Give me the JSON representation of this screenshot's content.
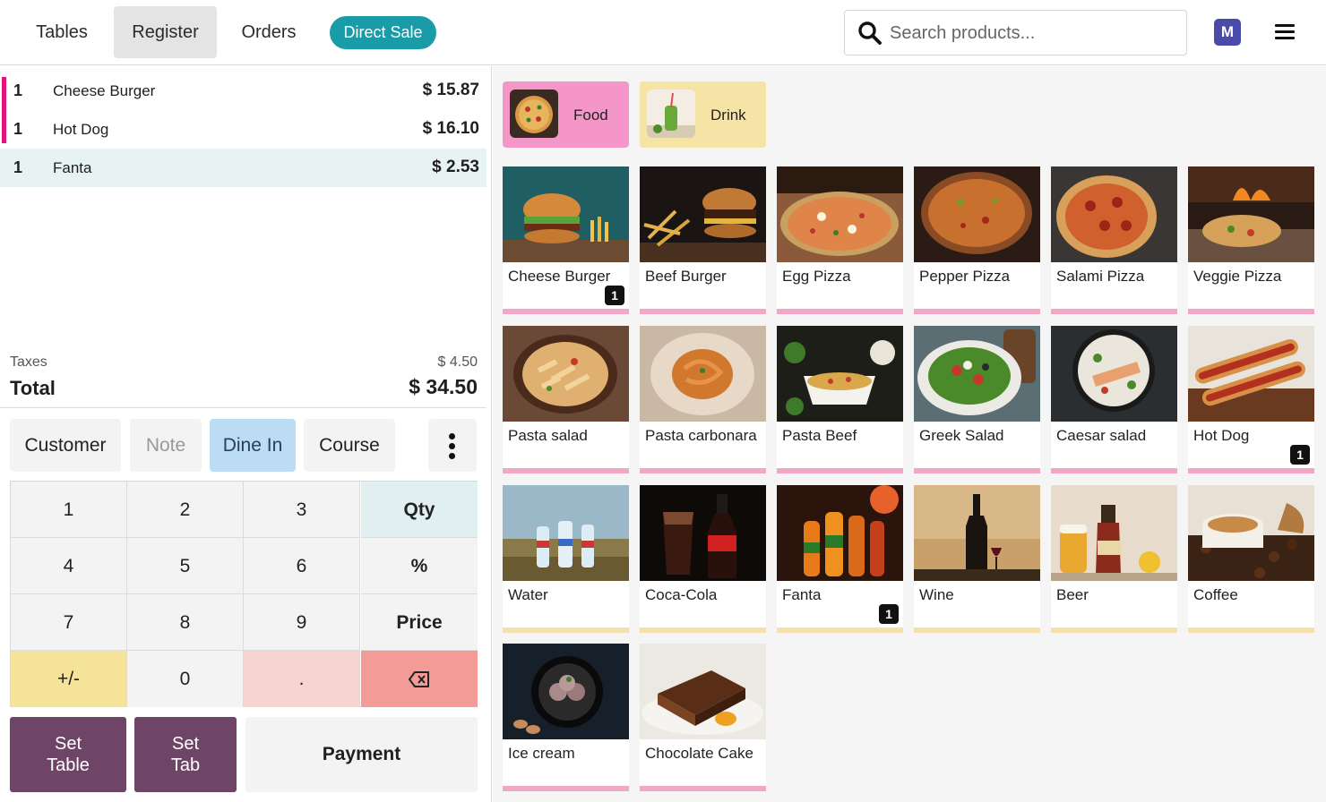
{
  "topbar": {
    "tabs": [
      {
        "label": "Tables"
      },
      {
        "label": "Register"
      },
      {
        "label": "Orders"
      }
    ],
    "direct_sale": "Direct Sale",
    "search_placeholder": "Search products...",
    "avatar": "M",
    "colors": {
      "accent": "#1a9ca8",
      "avatar": "#4a4aa8"
    }
  },
  "order": {
    "lines": [
      {
        "qty": "1",
        "name": "Cheese Burger",
        "price": "$ 15.87"
      },
      {
        "qty": "1",
        "name": "Hot Dog",
        "price": "$ 16.10"
      },
      {
        "qty": "1",
        "name": "Fanta",
        "price": "$ 2.53"
      }
    ],
    "taxes_label": "Taxes",
    "taxes_value": "$ 4.50",
    "total_label": "Total",
    "total_value": "$ 34.50"
  },
  "controls": {
    "customer": "Customer",
    "note": "Note",
    "dine_in": "Dine In",
    "course": "Course"
  },
  "numpad": {
    "k1": "1",
    "k2": "2",
    "k3": "3",
    "qty": "Qty",
    "k4": "4",
    "k5": "5",
    "k6": "6",
    "percent": "%",
    "k7": "7",
    "k8": "8",
    "k9": "9",
    "price": "Price",
    "sign": "+/-",
    "k0": "0",
    "dot": "."
  },
  "actions": {
    "set_table_1": "Set",
    "set_table_2": "Table",
    "set_tab_1": "Set",
    "set_tab_2": "Tab",
    "payment": "Payment"
  },
  "categories": [
    {
      "label": "Food",
      "color": "#f596c8"
    },
    {
      "label": "Drink",
      "color": "#f6e4a6"
    }
  ],
  "products": [
    {
      "name": "Cheese Burger",
      "badge": "1"
    },
    {
      "name": "Beef Burger"
    },
    {
      "name": "Egg Pizza"
    },
    {
      "name": "Pepper Pizza"
    },
    {
      "name": "Salami Pizza"
    },
    {
      "name": "Veggie Pizza"
    },
    {
      "name": "Pasta salad"
    },
    {
      "name": "Pasta carbonara"
    },
    {
      "name": "Pasta Beef"
    },
    {
      "name": "Greek Salad"
    },
    {
      "name": "Caesar salad"
    },
    {
      "name": "Hot Dog",
      "badge": "1"
    },
    {
      "name": "Water"
    },
    {
      "name": "Coca-Cola"
    },
    {
      "name": "Fanta",
      "badge": "1"
    },
    {
      "name": "Wine"
    },
    {
      "name": "Beer"
    },
    {
      "name": "Coffee"
    },
    {
      "name": "Ice cream"
    },
    {
      "name": "Chocolate Cake"
    }
  ]
}
